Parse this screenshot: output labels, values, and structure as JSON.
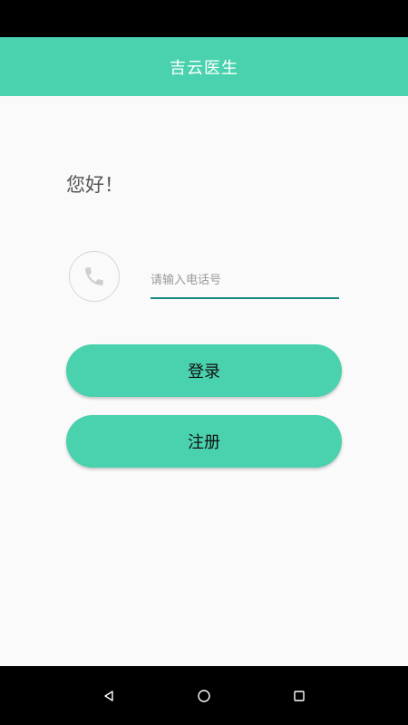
{
  "app_bar": {
    "title": "吉云医生"
  },
  "greeting": "您好！",
  "phone_field": {
    "icon": "phone-icon",
    "placeholder": "请输入电话号",
    "value": ""
  },
  "buttons": {
    "login_label": "登录",
    "register_label": "注册"
  },
  "nav": {
    "back_icon": "back-triangle-icon",
    "home_icon": "home-circle-icon",
    "recent_icon": "recent-square-icon"
  },
  "colors": {
    "accent": "#4ad1ae",
    "input_underline": "#158a80",
    "background": "#fafafa"
  }
}
